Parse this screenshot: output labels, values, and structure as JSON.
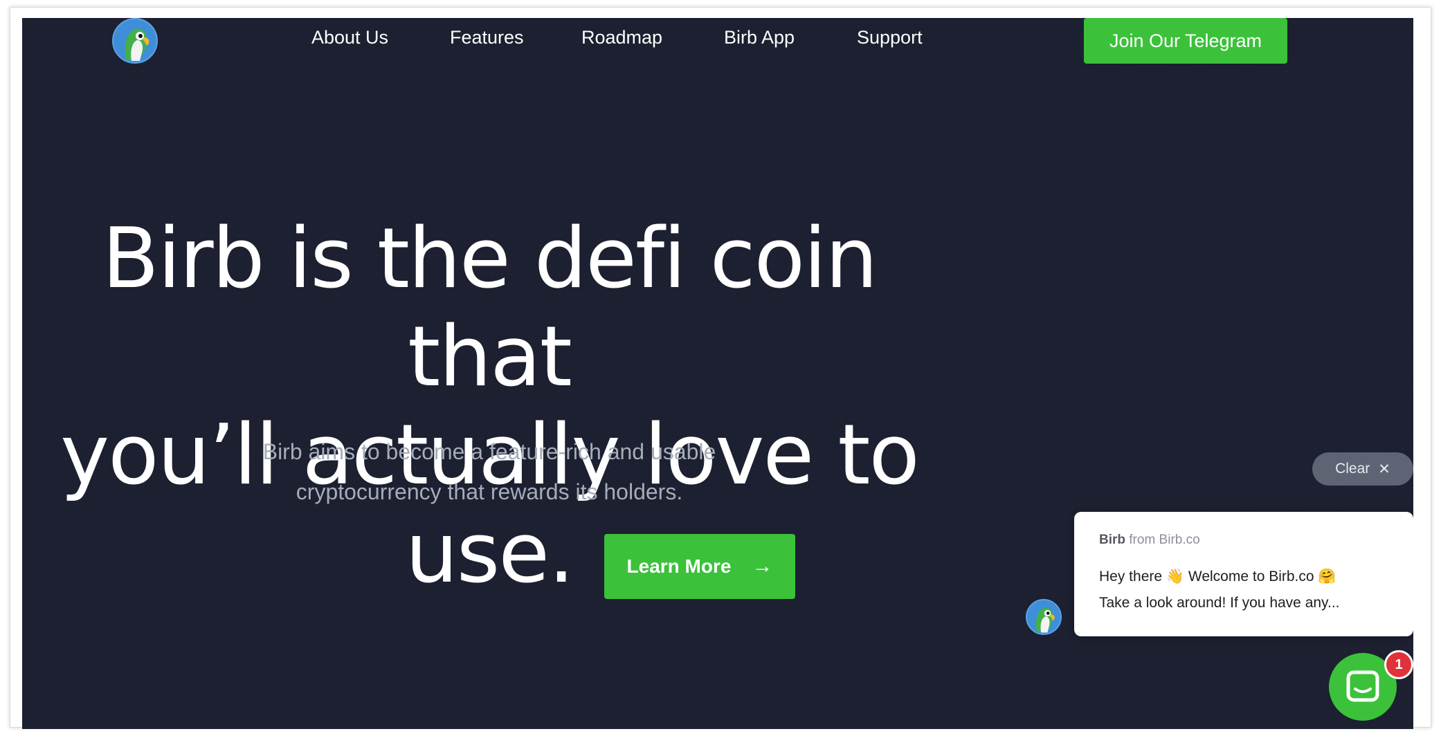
{
  "nav": {
    "logo_icon": "parrot-logo-icon",
    "links": [
      "About Us",
      "Features",
      "Roadmap",
      "Birb App",
      "Support"
    ],
    "cta_label": "Join Our Telegram"
  },
  "hero": {
    "title_line1": "Birb is the defi coin that",
    "title_line2": "you’ll actually love to use.",
    "subtitle_line1": "Birb aims to become a feature-rich and usable",
    "subtitle_line2": "cryptocurrency that rewards its holders.",
    "cta_label": "Learn More",
    "cta_icon": "arrow-right-icon"
  },
  "chat": {
    "clear_label": "Clear",
    "clear_icon": "close-icon",
    "sender_name": "Birb",
    "sender_from": "from Birb.co",
    "line1_a": "Hey there",
    "line1_b": "Welcome to Birb.co",
    "line2": "Take a look around! If you have any...",
    "emoji1": "waving-hand-icon",
    "emoji2": "hugging-face-icon",
    "launcher_icon": "chat-launcher-icon",
    "unread_count": "1"
  },
  "colors": {
    "background": "#1c2030",
    "accent_green": "#3cc13b",
    "badge_red": "#e0323a"
  }
}
